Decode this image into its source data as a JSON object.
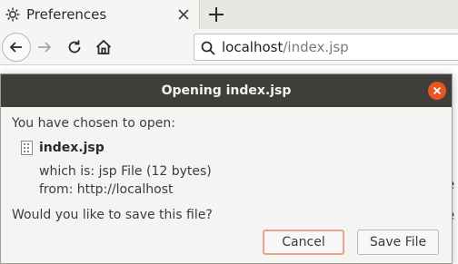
{
  "browser": {
    "tab": {
      "title": "Preferences",
      "icon": "gear-icon"
    },
    "url": {
      "host": "localhost",
      "path": "/index.jsp"
    }
  },
  "dialog": {
    "title": "Opening index.jsp",
    "intro": "You have chosen to open:",
    "file_name": "index.jsp",
    "which_is": "which is: jsp File (12 bytes)",
    "from": "from: http://localhost",
    "question": "Would you like to save this file?",
    "cancel_label": "Cancel",
    "save_label": "Save File"
  },
  "page": {
    "fragments": [
      "t",
      "e",
      "e"
    ]
  },
  "colors": {
    "accent": "#e95420",
    "titlebar": "#3f3e3a",
    "focus_border": "#e7a58c"
  }
}
